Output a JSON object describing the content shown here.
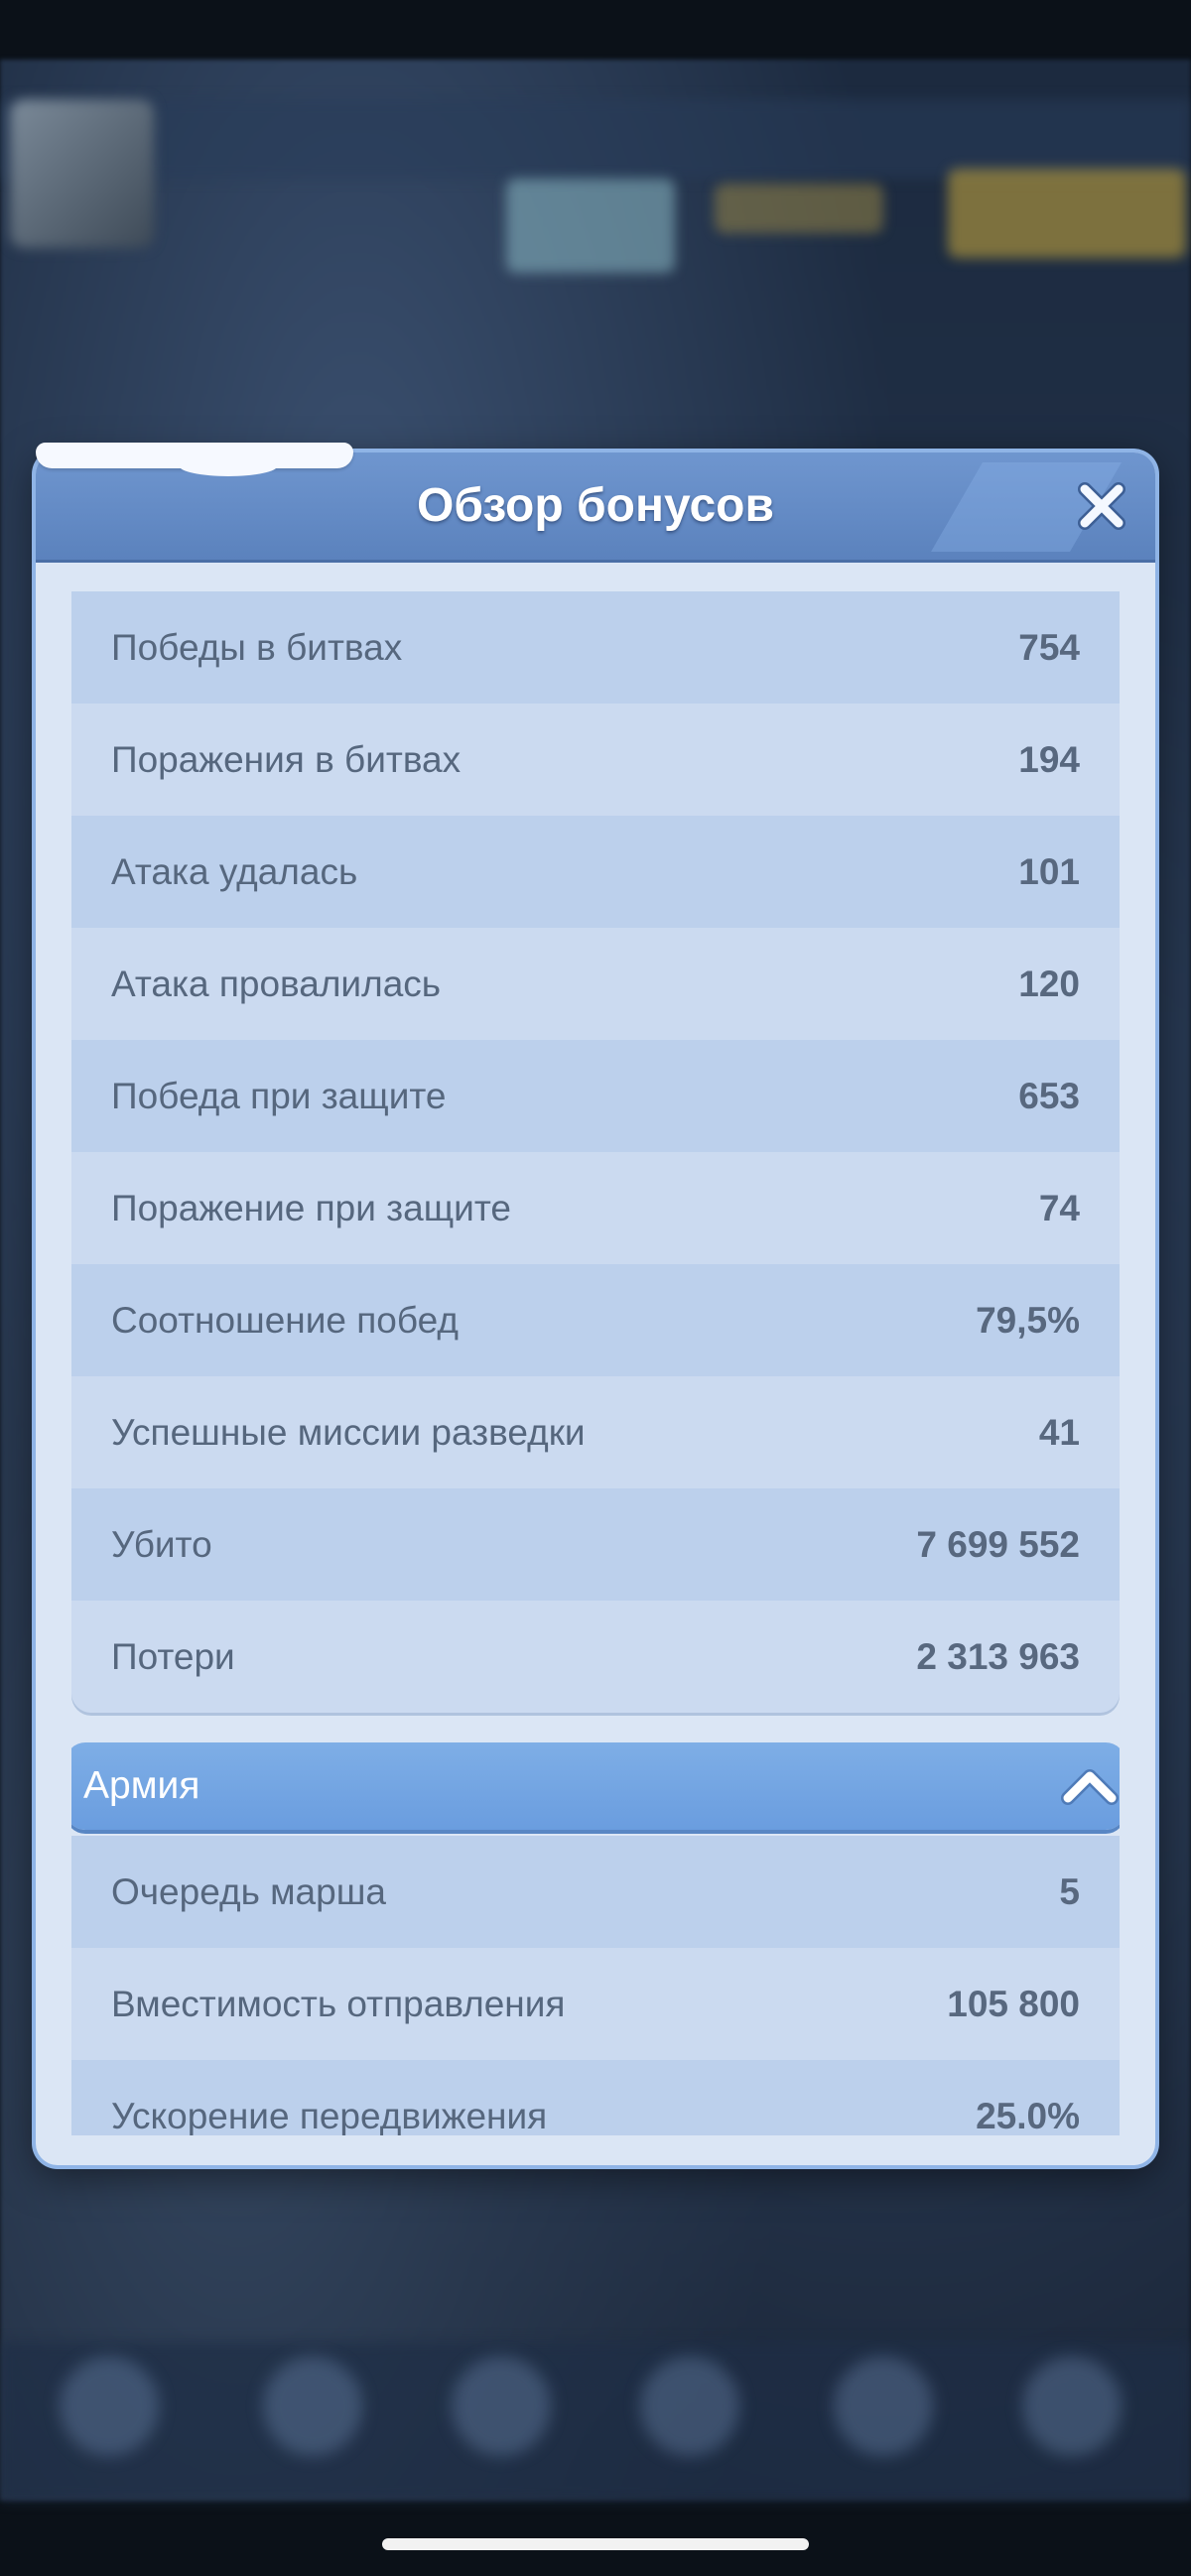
{
  "modal": {
    "title": "Обзор бонусов"
  },
  "battle_stats": [
    {
      "label": "Победы в битвах",
      "value": "754"
    },
    {
      "label": "Поражения в битвах",
      "value": "194"
    },
    {
      "label": "Атака удалась",
      "value": "101"
    },
    {
      "label": "Атака провалилась",
      "value": "120"
    },
    {
      "label": "Победа при защите",
      "value": "653"
    },
    {
      "label": "Поражение при защите",
      "value": "74"
    },
    {
      "label": "Соотношение побед",
      "value": "79,5%"
    },
    {
      "label": "Успешные миссии разведки",
      "value": "41"
    },
    {
      "label": "Убито",
      "value": "7 699 552"
    },
    {
      "label": "Потери",
      "value": "2 313 963"
    }
  ],
  "army_section": {
    "title": "Армия",
    "items": [
      {
        "label": "Очередь марша",
        "value": "5"
      },
      {
        "label": "Вместимость отправления",
        "value": "105 800"
      },
      {
        "label": "Ускорение передвижения",
        "value": "25.0%"
      }
    ]
  },
  "colors": {
    "header": "#5b82bd",
    "modal_bg": "#dbe6f5",
    "section_header": "#6a9ddf",
    "text": "#56677e"
  },
  "icons": {
    "close": "close-icon",
    "collapse": "chevron-up-icon"
  }
}
